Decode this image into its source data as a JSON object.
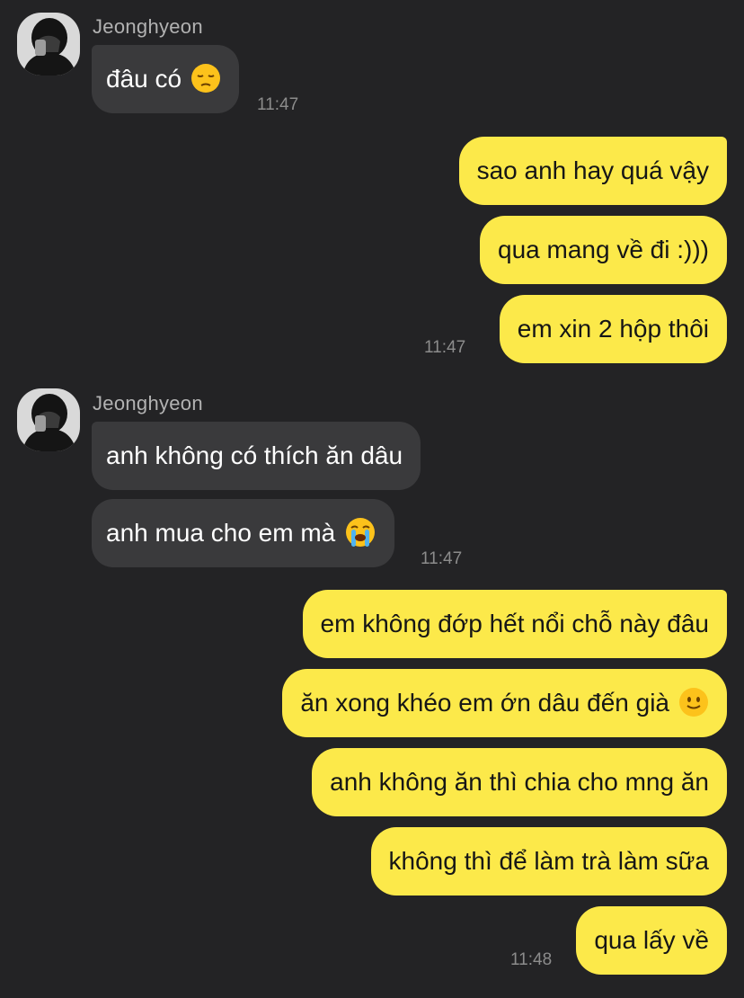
{
  "sender": {
    "name": "Jeonghyeon",
    "avatar": "profile-photo"
  },
  "messages": [
    {
      "from": "them",
      "text": "đâu có",
      "emoji": "pensive-face-emoji"
    },
    {
      "from": "them_time",
      "text": "11:47"
    },
    {
      "from": "me",
      "text": "sao anh hay quá vậy"
    },
    {
      "from": "me",
      "text": "qua mang về đi :)))"
    },
    {
      "from": "me",
      "text": "em xin 2 hộp thôi"
    },
    {
      "from": "me_time",
      "text": "11:47"
    },
    {
      "from": "them",
      "text": "anh không có thích ăn dâu"
    },
    {
      "from": "them",
      "text": "anh mua cho em mà",
      "emoji": "loudly-crying-face-emoji"
    },
    {
      "from": "them_time",
      "text": "11:47"
    },
    {
      "from": "me",
      "text": "em không đớp hết nổi chỗ này đâu"
    },
    {
      "from": "me",
      "text": "ăn xong khéo em ớn dâu đến già",
      "emoji": "slightly-smiling-face-emoji"
    },
    {
      "from": "me",
      "text": "anh không ăn thì chia cho mng ăn"
    },
    {
      "from": "me",
      "text": "không thì để làm trà làm sữa"
    },
    {
      "from": "me",
      "text": "qua lấy về"
    },
    {
      "from": "me_time",
      "text": "11:48"
    }
  ],
  "colors": {
    "background": "#232325",
    "incoming_bubble": "#3a3a3c",
    "outgoing_bubble": "#fce94a"
  }
}
